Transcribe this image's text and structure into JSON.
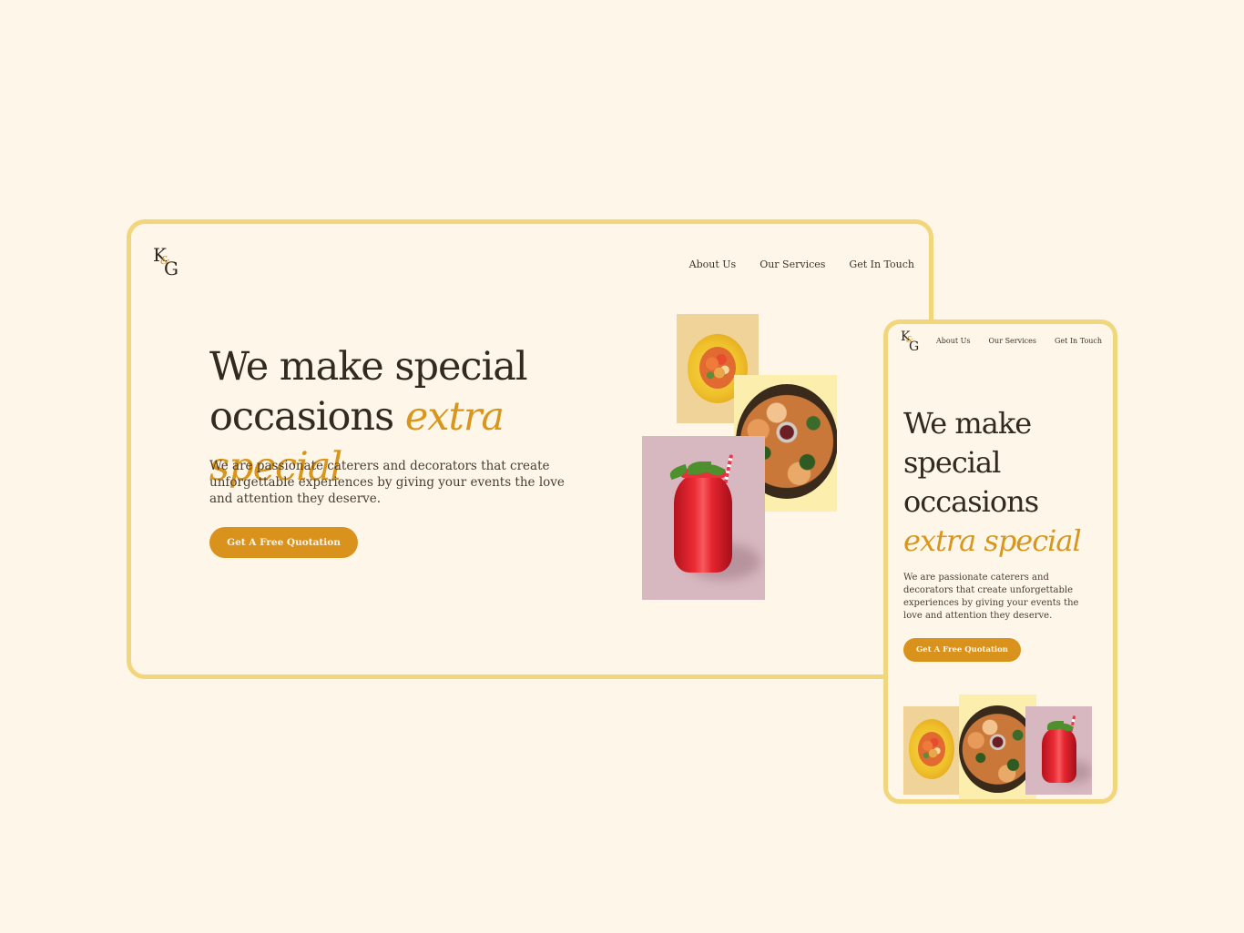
{
  "brand": {
    "logo_k": "K",
    "logo_amp": "&",
    "logo_g": "G",
    "colors": {
      "background": "#FFF6EA",
      "frame_border": "#F2D67C",
      "accent": "#D8961D",
      "button": "#D9921C",
      "text": "#33291F"
    }
  },
  "nav": {
    "about": "About Us",
    "services": "Our Services",
    "contact": "Get In Touch"
  },
  "hero": {
    "headline_line1": "We make special",
    "headline_line2": "occasions",
    "headline_mobile_1": "We make",
    "headline_mobile_2": "special",
    "headline_mobile_3": "occasions",
    "headline_accent": "extra special",
    "description": "We are passionate caterers and decorators that create unforgettable experiences by giving your events the love and attention they deserve.",
    "cta_label": "Get A Free Quotation"
  },
  "images": [
    {
      "name": "stuffed-lemon",
      "background": "#F0D398"
    },
    {
      "name": "platter",
      "background": "#FCEFAE"
    },
    {
      "name": "red-drink",
      "background": "#D8B8C0"
    }
  ]
}
